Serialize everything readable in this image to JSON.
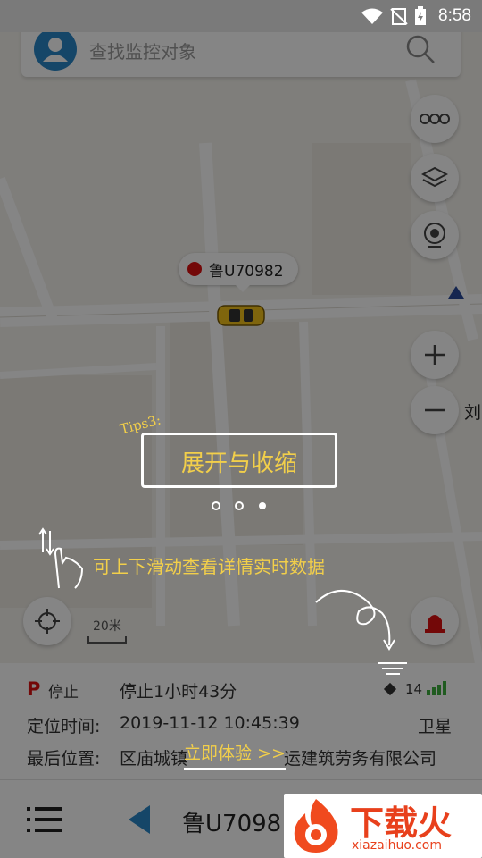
{
  "status_bar": {
    "time": "8:58"
  },
  "search": {
    "placeholder": "查找监控对象"
  },
  "map": {
    "vehicle_plate": "鲁U70982",
    "scale_label": "20米",
    "poi_fragment": "刘"
  },
  "info": {
    "status_badge": "P",
    "status": "停止",
    "duration": "停止1小时43分",
    "signal_count": "14",
    "time_label": "定位时间:",
    "time_value": "2019-11-12 10:45:39",
    "positioning": "卫星",
    "location_label": "最后位置:",
    "location_value": "区庙城镇",
    "location_tail": "运建筑劳务有限公司"
  },
  "bottom": {
    "plate": "鲁U7098"
  },
  "tips": {
    "tag": "Tips3:",
    "title": "展开与收缩",
    "hint": "可上下滑动查看详情实时数据",
    "cta": "立即体验 >>"
  },
  "watermark": {
    "brand": "下载火",
    "url": "xiazaihuo.com"
  },
  "colors": {
    "accent_blue": "#2a86c8",
    "status_red": "#dd1111",
    "tips_yellow": "#f2cf4a",
    "taxi_yellow": "#f4c21a",
    "signal_green": "#3fae3f"
  }
}
